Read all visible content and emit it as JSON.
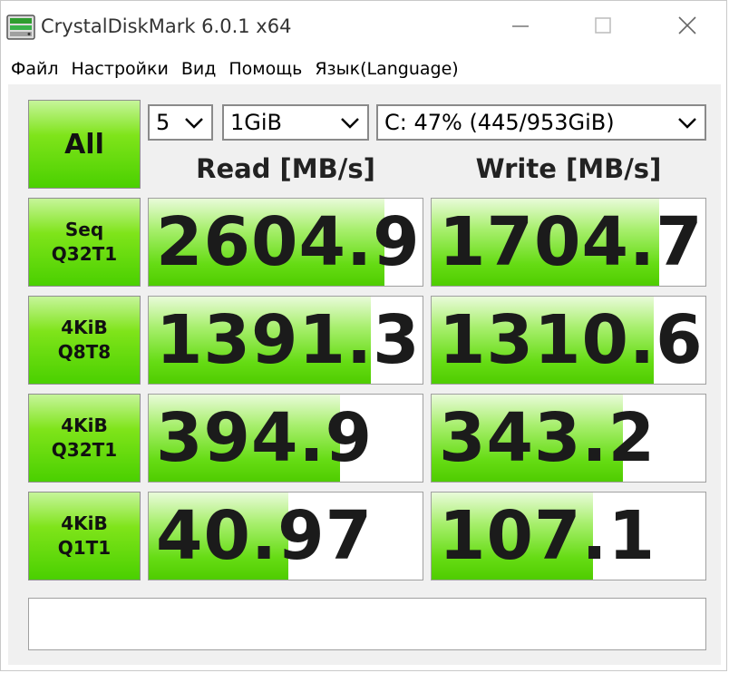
{
  "window": {
    "title": "CrystalDiskMark 6.0.1 x64"
  },
  "menu": [
    "Файл",
    "Настройки",
    "Вид",
    "Помощь",
    "Язык(Language)"
  ],
  "controls": {
    "all_label": "All",
    "count_value": "5",
    "size_value": "1GiB",
    "drive_value": "C: 47% (445/953GiB)"
  },
  "headers": {
    "read": "Read [MB/s]",
    "write": "Write [MB/s]"
  },
  "tests": [
    {
      "label": "Seq\nQ32T1",
      "read": "2604.9",
      "write": "1704.7",
      "read_fill": 0.86,
      "write_fill": 0.83
    },
    {
      "label": "4KiB\nQ8T8",
      "read": "1391.3",
      "write": "1310.6",
      "read_fill": 0.81,
      "write_fill": 0.81
    },
    {
      "label": "4KiB\nQ32T1",
      "read": "394.9",
      "write": "343.2",
      "read_fill": 0.7,
      "write_fill": 0.7
    },
    {
      "label": "4KiB\nQ1T1",
      "read": "40.97",
      "write": "107.1",
      "read_fill": 0.51,
      "write_fill": 0.59
    }
  ],
  "status_text": "",
  "colors": {
    "tile_green": "#4ad000",
    "bar_green": "#66dc14",
    "background": "#f0f0f0"
  },
  "icons": {
    "app": "disk-icon",
    "minimize": "minimize-icon",
    "maximize": "maximize-icon",
    "close": "close-icon",
    "dropdown": "chevron-down-icon"
  }
}
